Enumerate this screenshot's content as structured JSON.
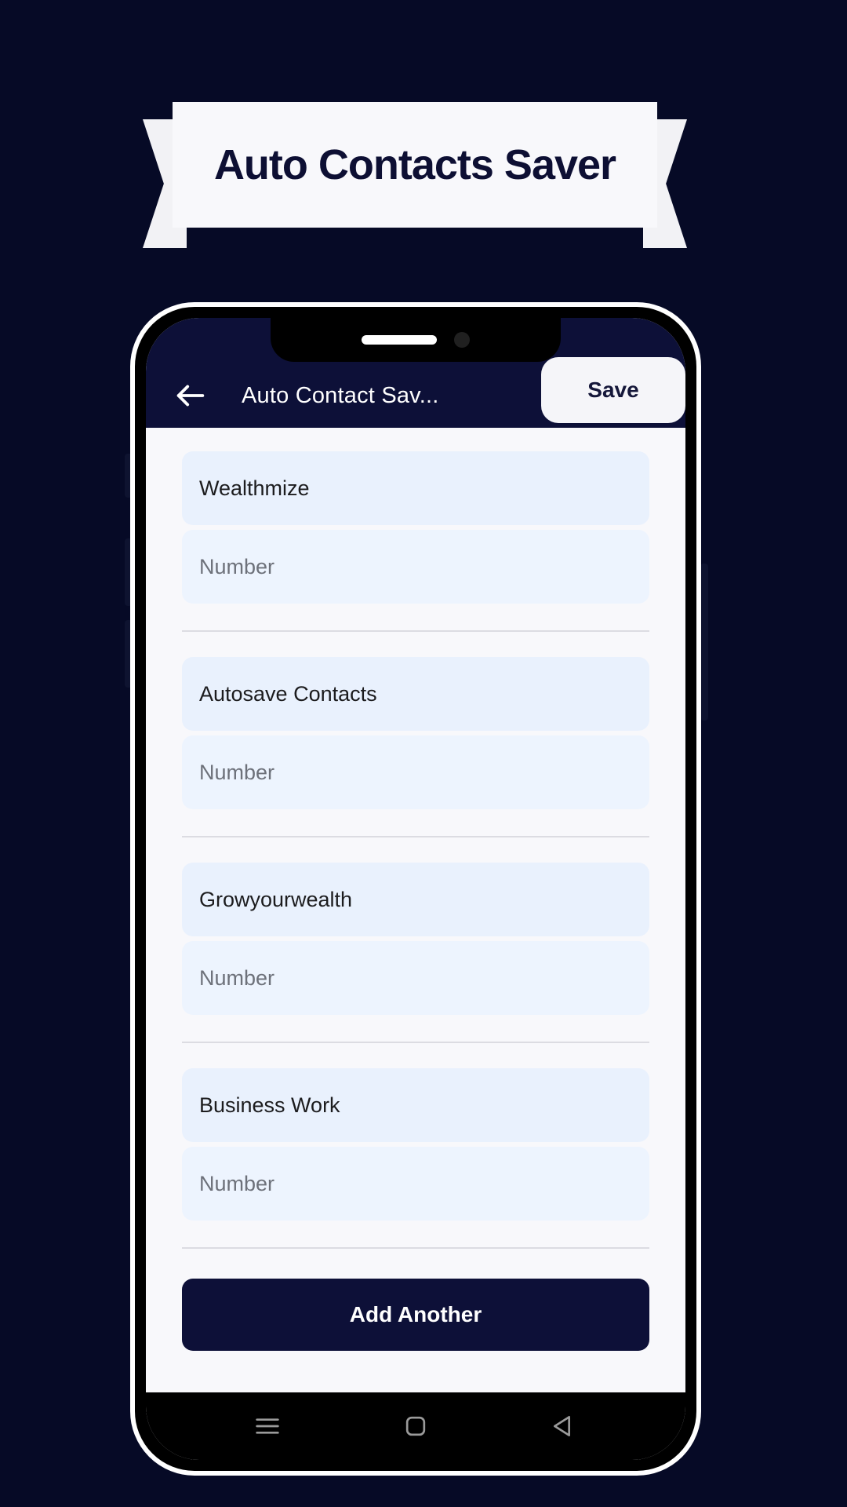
{
  "banner": {
    "title": "Auto Contacts Saver",
    "background": "#f8f8fb",
    "text_color": "#0d0f33"
  },
  "page": {
    "background": "#060a26"
  },
  "phone": {
    "frame_color": "#ffffff",
    "notch": {
      "speaker_icon": "speaker-grill",
      "camera_icon": "front-camera"
    }
  },
  "appbar": {
    "background": "#0d1038",
    "back_icon": "arrow-left-icon",
    "title": "Auto Contact Sav...",
    "save_label": "Save"
  },
  "form": {
    "groups": [
      {
        "name_value": "Wealthmize",
        "number_placeholder": "Number"
      },
      {
        "name_value": "Autosave Contacts",
        "number_placeholder": "Number"
      },
      {
        "name_value": "Growyourwealth",
        "number_placeholder": "Number"
      },
      {
        "name_value": "Business Work",
        "number_placeholder": "Number"
      }
    ],
    "field_background": "#e9f1fd",
    "add_another_label": "Add Another",
    "add_another_background": "#0d1038"
  },
  "navbar": {
    "items": [
      {
        "icon": "menu-icon"
      },
      {
        "icon": "home-square-icon"
      },
      {
        "icon": "back-triangle-icon"
      }
    ]
  }
}
